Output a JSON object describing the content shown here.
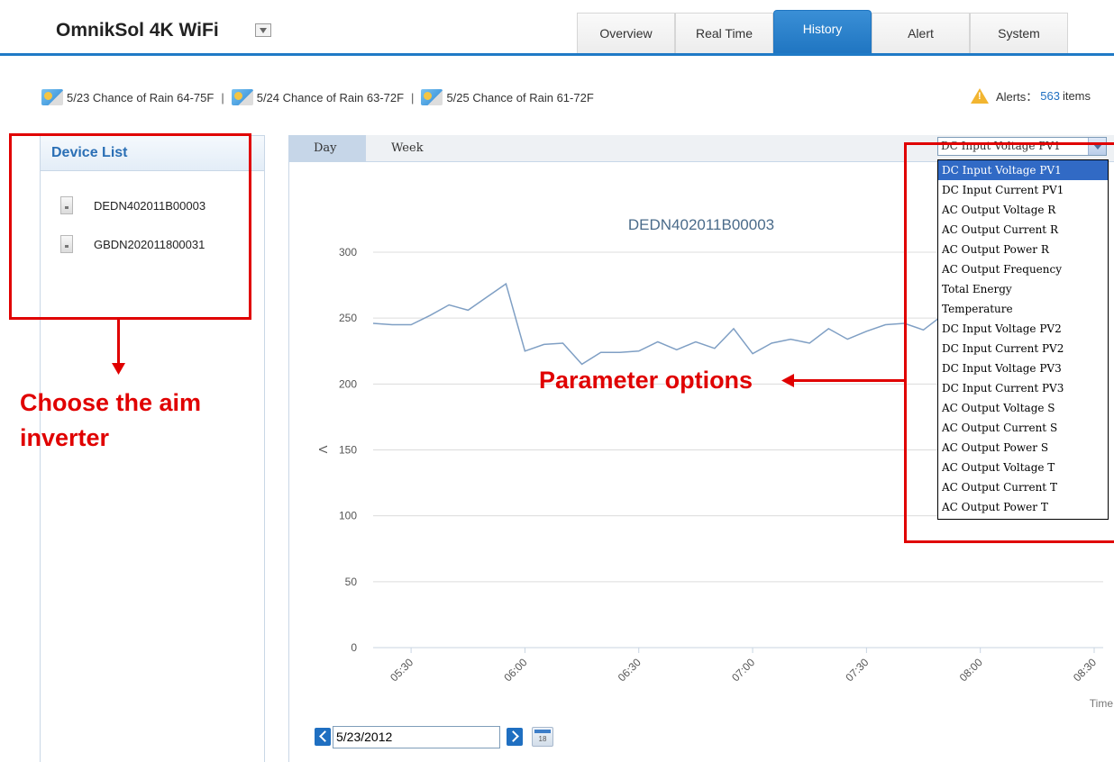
{
  "app": {
    "title": "OmnikSol 4K WiFi"
  },
  "tabs": [
    {
      "label": "Overview",
      "active": false
    },
    {
      "label": "Real Time",
      "active": false
    },
    {
      "label": "History",
      "active": true
    },
    {
      "label": "Alert",
      "active": false
    },
    {
      "label": "System",
      "active": false
    }
  ],
  "weather": [
    {
      "text": "5/23 Chance of Rain 64-75F",
      "icon": "partly-cloudy-icon"
    },
    {
      "text": "5/24 Chance of Rain 63-72F",
      "icon": "partly-cloudy-icon"
    },
    {
      "text": "5/25 Chance of Rain 61-72F",
      "icon": "partly-cloudy-icon"
    }
  ],
  "weather_separator": "|",
  "alerts": {
    "label": "Alerts：",
    "count": "563",
    "unit": "items"
  },
  "sidebar": {
    "title": "Device List",
    "devices": [
      "DEDN402011B00003",
      "GBDN202011800031"
    ]
  },
  "range_tabs": [
    "Day",
    "Week"
  ],
  "parameter": {
    "selected": "DC Input Voltage PV1",
    "options": [
      "DC Input Voltage PV1",
      "DC Input Current PV1",
      "AC Output Voltage R",
      "AC Output Current R",
      "AC Output Power R",
      "AC Output Frequency",
      "Total Energy",
      "Temperature",
      "DC Input Voltage PV2",
      "DC Input Current PV2",
      "DC Input Voltage PV3",
      "DC Input Current PV3",
      "AC Output Voltage S",
      "AC Output Current S",
      "AC Output Power S",
      "AC Output Voltage T",
      "AC Output Current T",
      "AC Output Power T"
    ]
  },
  "date": {
    "value": "5/23/2012",
    "calendar_icon_text": "18"
  },
  "annotations": {
    "inverter": "Choose the aim inverter",
    "parameter": "Parameter options"
  },
  "colors": {
    "accent": "#1f7ac6",
    "line": "#7f9fc4",
    "annotation": "#e00000"
  },
  "chart_data": {
    "type": "line",
    "title": "DEDN402011B00003",
    "ylabel": "V",
    "xlabel": "Time",
    "ylim": [
      0,
      300
    ],
    "yticks": [
      0,
      50,
      100,
      150,
      200,
      250,
      300
    ],
    "xlim": [
      "05:20",
      "08:30"
    ],
    "xticks": [
      "05:30",
      "06:00",
      "06:30",
      "07:00",
      "07:30",
      "08:00",
      "08:30"
    ],
    "series": [
      {
        "x": [
          "05:20",
          "05:25",
          "05:30",
          "05:35",
          "05:40",
          "05:45",
          "05:50",
          "05:55",
          "06:00",
          "06:05",
          "06:10",
          "06:15",
          "06:20",
          "06:25",
          "06:30",
          "06:35",
          "06:40",
          "06:45",
          "06:50",
          "06:55",
          "07:00",
          "07:05",
          "07:10",
          "07:15",
          "07:20",
          "07:25",
          "07:30",
          "07:35",
          "07:40",
          "07:45",
          "07:50"
        ],
        "y": [
          246,
          245,
          245,
          252,
          260,
          256,
          266,
          276,
          225,
          230,
          231,
          215,
          224,
          224,
          225,
          232,
          226,
          232,
          227,
          242,
          223,
          231,
          234,
          231,
          242,
          234,
          240,
          245,
          246,
          241,
          252
        ]
      }
    ]
  }
}
